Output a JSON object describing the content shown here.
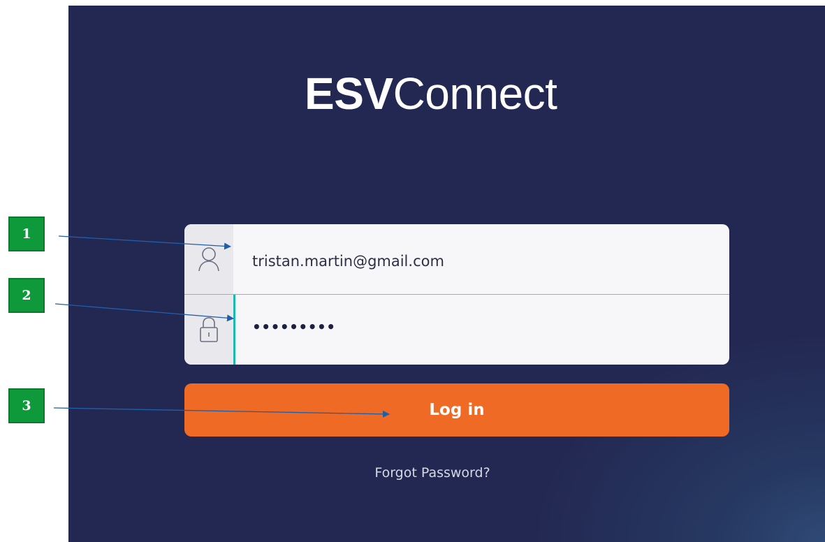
{
  "logo": {
    "bold": "ESV",
    "light": "Connect"
  },
  "login_form": {
    "email_value": "tristan.martin@gmail.com",
    "password_mask": "•••••••••",
    "email_icon": "user-icon",
    "password_icon": "lock-icon",
    "login_label": "Log in",
    "forgot_label": "Forgot Password?"
  },
  "annotations": [
    {
      "label": "1"
    },
    {
      "label": "2"
    },
    {
      "label": "3"
    }
  ],
  "colors": {
    "background": "#232852",
    "button": "#ee6a25",
    "focus": "#1db8b3",
    "callout": "#0e9a3a",
    "arrow": "#1f5fa8"
  }
}
